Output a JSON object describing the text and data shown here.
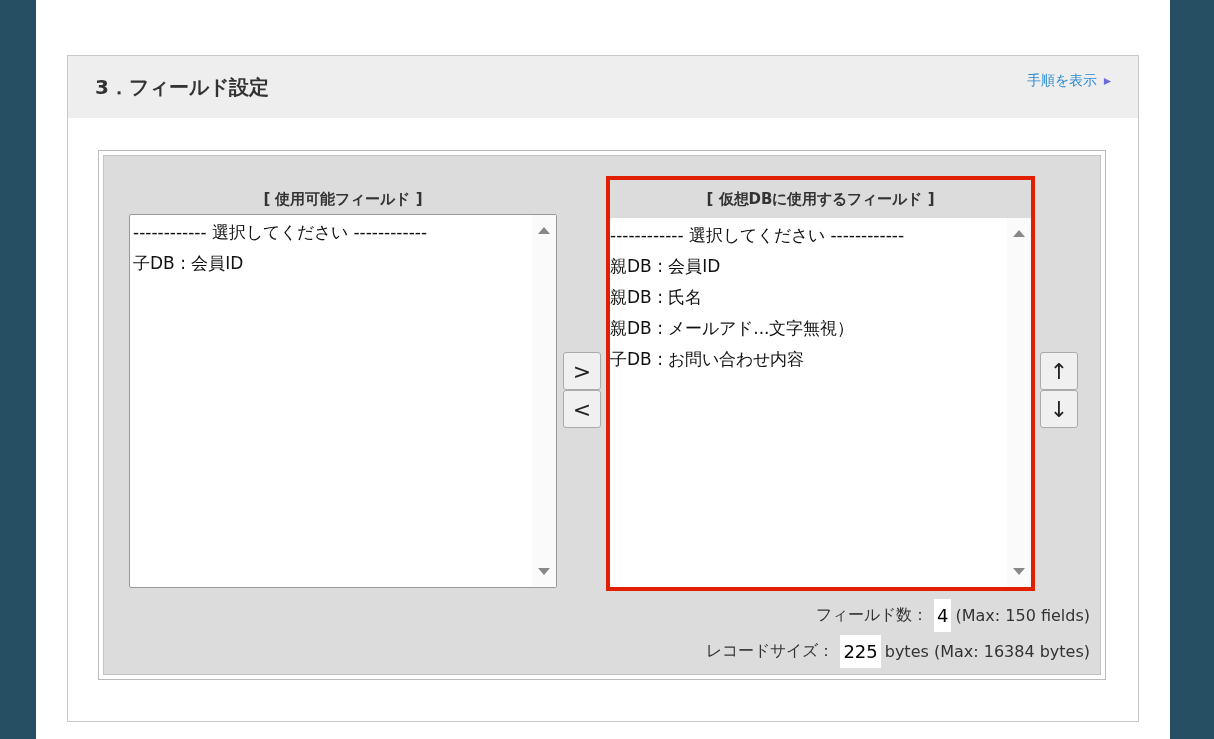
{
  "section": {
    "title": "3．フィールド設定",
    "help_link": "手順を表示"
  },
  "lists": [
    {
      "heading": "[ 使用可能フィールド ]",
      "highlighted": false,
      "options": [
        "------------ 選択してください ------------",
        "子DB : 会員ID"
      ]
    },
    {
      "heading": "[ 仮想DBに使用するフィールド ]",
      "highlighted": true,
      "options": [
        "------------ 選択してください ------------",
        "親DB : 会員ID",
        "親DB : 氏名",
        "親DB : メールアド...文字無視）",
        "子DB : お問い合わせ内容"
      ]
    }
  ],
  "transfer_buttons": [
    ">",
    "<"
  ],
  "order_buttons": [
    "↑",
    "↓"
  ],
  "stats": [
    {
      "label": "フィールド数：",
      "value": "4",
      "note": "(Max: 150 fields)"
    },
    {
      "label": "レコードサイズ：",
      "value": "225",
      "note": "bytes (Max: 16384 bytes)"
    }
  ]
}
